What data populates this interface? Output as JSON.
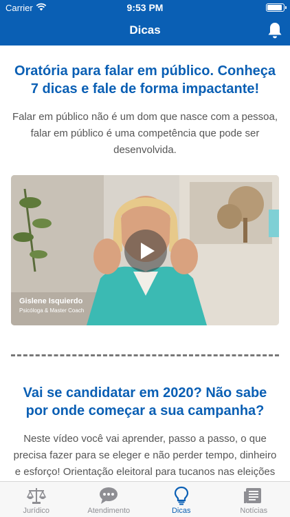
{
  "status_bar": {
    "carrier": "Carrier",
    "time": "9:53 PM"
  },
  "nav": {
    "title": "Dicas"
  },
  "articles": [
    {
      "title": "Oratória para falar em público. Conheça 7 dicas e fale de forma impactante!",
      "body": "Falar em público não é um dom que nasce com a pessoa, falar em público é uma competência que pode ser desenvolvida.",
      "video": {
        "caption_name": "Gislene Isquierdo",
        "caption_role": "Psicóloga & Master Coach"
      }
    },
    {
      "title": "Vai se candidatar em 2020? Não sabe por onde começar a sua campanha?",
      "body": "Neste vídeo você vai aprender, passo a passo, o que precisa fazer para se eleger e não perder tempo, dinheiro e esforço! Orientação eleitoral para tucanos nas eleições"
    }
  ],
  "tabs": [
    {
      "label": "Jurídico",
      "icon": "scale-icon",
      "active": false
    },
    {
      "label": "Atendimento",
      "icon": "chat-bubble-icon",
      "active": false
    },
    {
      "label": "Dicas",
      "icon": "lightbulb-icon",
      "active": true
    },
    {
      "label": "Notícias",
      "icon": "newspaper-icon",
      "active": false
    }
  ],
  "colors": {
    "primary": "#0a5fb4",
    "text": "#555555",
    "inactive_tab": "#8e8e93",
    "tab_bar_bg": "#f7f7f7"
  }
}
